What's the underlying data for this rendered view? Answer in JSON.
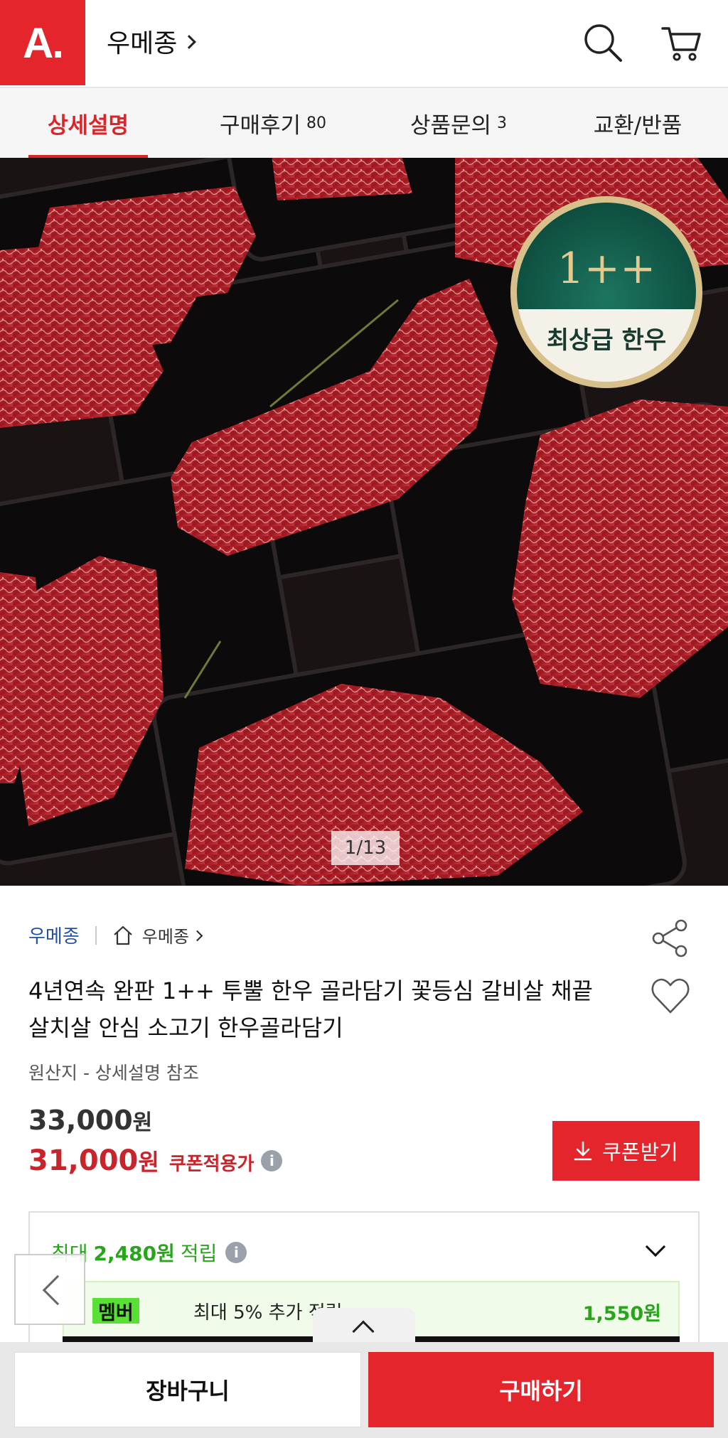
{
  "header": {
    "logo": "A.",
    "store_link": "우메종"
  },
  "tabs": [
    {
      "label": "상세설명",
      "count": ""
    },
    {
      "label": "구매후기",
      "count": "80"
    },
    {
      "label": "상품문의",
      "count": "3"
    },
    {
      "label": "교환/반품",
      "count": ""
    }
  ],
  "hero": {
    "counter": "1/13",
    "badge_grade": "1++",
    "badge_label": "최상급 한우"
  },
  "product": {
    "seller_name": "우메종",
    "seller_home": "우메종",
    "title": "4년연속 완판 1++ 투뿔 한우 골라담기 꽃등심 갈비살 채끝 살치살 안심 소고기 한우골라담기",
    "origin": "원산지 - 상세설명 참조",
    "price_original": "33,000",
    "price_sale": "31,000",
    "currency": "원",
    "coupon_price_label": "쿠폰적용가",
    "coupon_button": "쿠폰받기"
  },
  "reward": {
    "prefix": "최대",
    "amount": "2,480원",
    "suffix": "적립",
    "member_badge": "멤버",
    "member_text": "최대 5% 추가 적립",
    "member_amount": "1,550원"
  },
  "bottom_bar": {
    "cart_label": "장바구니",
    "buy_label": "구매하기"
  },
  "colors": {
    "brand_red": "#e4262c",
    "reward_green": "#29a51c",
    "seller_blue": "#2350a6"
  }
}
